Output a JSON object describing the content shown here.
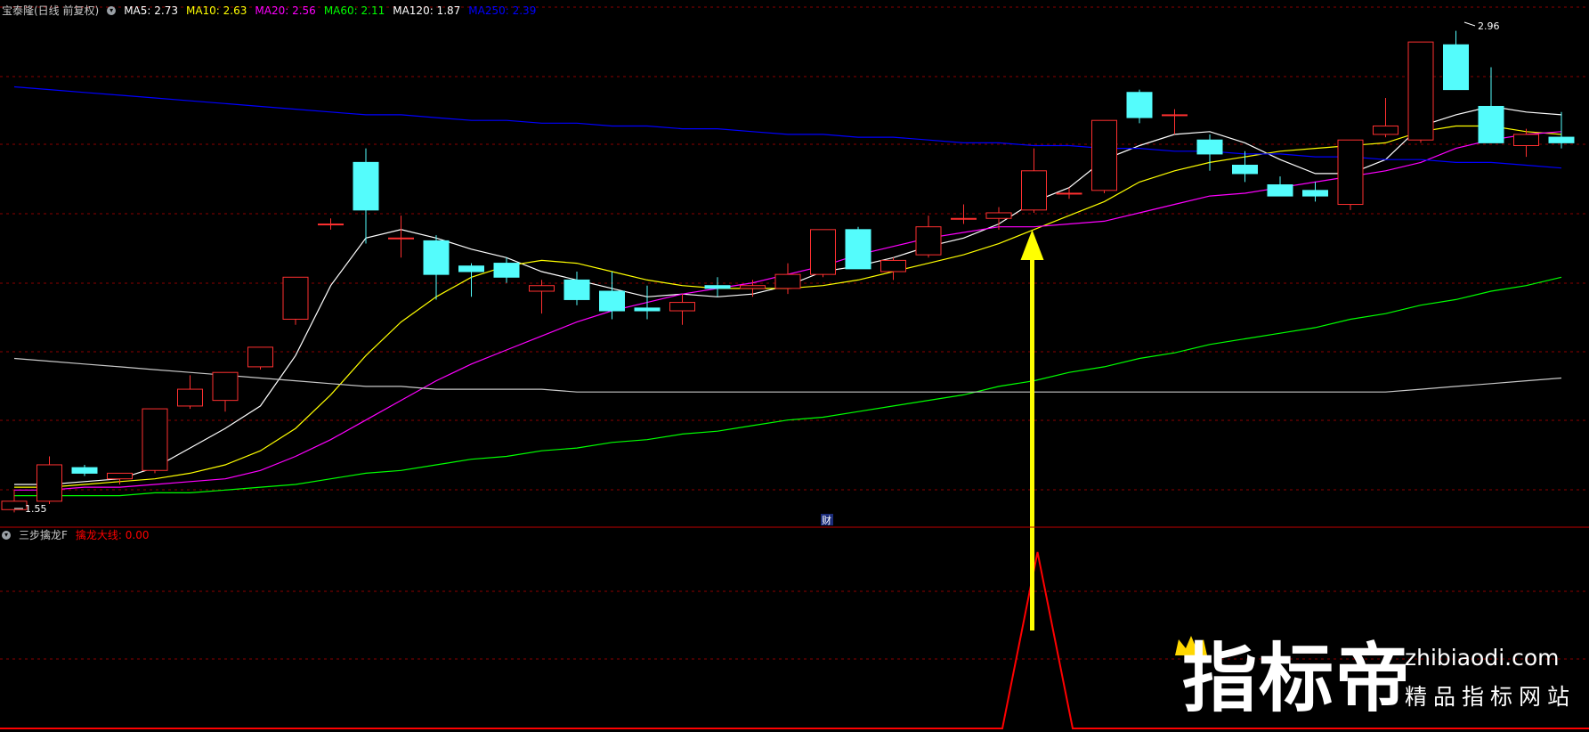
{
  "main_panel": {
    "title": "宝泰隆(日线 前复权)",
    "ma_labels": [
      {
        "text": "MA5: 2.73",
        "color": "#ffffff"
      },
      {
        "text": "MA10: 2.63",
        "color": "#ffff00"
      },
      {
        "text": "MA20: 2.56",
        "color": "#ff00ff"
      },
      {
        "text": "MA60: 2.11",
        "color": "#00ff00"
      },
      {
        "text": "MA120: 1.87",
        "color": "#ffffff"
      },
      {
        "text": "MA250: 2.39",
        "color": "#0000ff"
      }
    ],
    "high_marker": "2.96",
    "low_marker": "1.55",
    "fin_badge": "财"
  },
  "sub_panel": {
    "title": "三步擒龙F",
    "indicator_label": "擒龙大线: 0.00",
    "indicator_color": "#ff0000"
  },
  "watermark": {
    "brand": "指标帝",
    "url": "zhibiaodi.com",
    "slogan": "精品指标网站"
  },
  "colors": {
    "up": "#ff3030",
    "down": "#54fcfc",
    "grid": "#8b0000",
    "arrow": "#ffff00"
  },
  "chart_data": {
    "type": "candlestick",
    "ohlc": [
      [
        1.55,
        1.62,
        1.54,
        1.58
      ],
      [
        1.58,
        1.74,
        1.57,
        1.71
      ],
      [
        1.7,
        1.71,
        1.67,
        1.68
      ],
      [
        1.66,
        1.68,
        1.64,
        1.68
      ],
      [
        1.69,
        1.91,
        1.68,
        1.91
      ],
      [
        1.92,
        2.03,
        1.91,
        1.98
      ],
      [
        1.94,
        2.04,
        1.9,
        2.04
      ],
      [
        2.06,
        2.13,
        2.05,
        2.13
      ],
      [
        2.23,
        2.38,
        2.21,
        2.38
      ],
      [
        2.57,
        2.59,
        2.55,
        2.57
      ],
      [
        2.79,
        2.84,
        2.5,
        2.62
      ],
      [
        2.52,
        2.6,
        2.45,
        2.52
      ],
      [
        2.51,
        2.53,
        2.3,
        2.39
      ],
      [
        2.42,
        2.43,
        2.31,
        2.4
      ],
      [
        2.43,
        2.45,
        2.36,
        2.38
      ],
      [
        2.33,
        2.37,
        2.25,
        2.35
      ],
      [
        2.37,
        2.4,
        2.28,
        2.3
      ],
      [
        2.33,
        2.4,
        2.23,
        2.26
      ],
      [
        2.27,
        2.35,
        2.23,
        2.26
      ],
      [
        2.26,
        2.32,
        2.21,
        2.29
      ],
      [
        2.35,
        2.38,
        2.31,
        2.34
      ],
      [
        2.34,
        2.37,
        2.31,
        2.35
      ],
      [
        2.34,
        2.43,
        2.32,
        2.39
      ],
      [
        2.39,
        2.55,
        2.38,
        2.55
      ],
      [
        2.55,
        2.56,
        2.41,
        2.41
      ],
      [
        2.4,
        2.45,
        2.37,
        2.44
      ],
      [
        2.46,
        2.6,
        2.45,
        2.56
      ],
      [
        2.59,
        2.64,
        2.57,
        2.59
      ],
      [
        2.59,
        2.63,
        2.55,
        2.61
      ],
      [
        2.62,
        2.84,
        2.61,
        2.76
      ],
      [
        2.68,
        2.7,
        2.66,
        2.68
      ],
      [
        2.69,
        2.93,
        2.68,
        2.94
      ],
      [
        3.04,
        3.05,
        2.93,
        2.95
      ],
      [
        2.96,
        2.98,
        2.89,
        2.96
      ],
      [
        2.87,
        2.89,
        2.76,
        2.82
      ],
      [
        2.78,
        2.83,
        2.72,
        2.75
      ],
      [
        2.71,
        2.74,
        2.67,
        2.67
      ],
      [
        2.69,
        2.72,
        2.65,
        2.67
      ],
      [
        2.64,
        2.87,
        2.62,
        2.87
      ],
      [
        2.89,
        3.02,
        2.88,
        2.92
      ],
      [
        2.87,
        3.22,
        2.86,
        3.22
      ],
      [
        3.21,
        3.26,
        3.05,
        3.05
      ],
      [
        2.99,
        3.13,
        2.87,
        2.86
      ],
      [
        2.85,
        2.91,
        2.81,
        2.89
      ],
      [
        2.88,
        2.97,
        2.84,
        2.86
      ]
    ],
    "ma_series": [
      {
        "name": "MA5",
        "color": "#ffffff",
        "y": [
          1.64,
          1.64,
          1.65,
          1.66,
          1.7,
          1.77,
          1.84,
          1.92,
          2.1,
          2.35,
          2.52,
          2.55,
          2.52,
          2.48,
          2.45,
          2.4,
          2.37,
          2.34,
          2.31,
          2.32,
          2.31,
          2.32,
          2.35,
          2.4,
          2.42,
          2.45,
          2.49,
          2.52,
          2.57,
          2.65,
          2.7,
          2.8,
          2.85,
          2.89,
          2.9,
          2.86,
          2.8,
          2.75,
          2.75,
          2.8,
          2.92,
          2.96,
          2.99,
          2.97,
          2.96
        ]
      },
      {
        "name": "MA10",
        "color": "#ffff00",
        "y": [
          1.63,
          1.63,
          1.64,
          1.65,
          1.66,
          1.68,
          1.71,
          1.76,
          1.84,
          1.96,
          2.1,
          2.22,
          2.31,
          2.38,
          2.42,
          2.44,
          2.43,
          2.4,
          2.37,
          2.35,
          2.34,
          2.34,
          2.34,
          2.35,
          2.37,
          2.4,
          2.43,
          2.46,
          2.5,
          2.55,
          2.6,
          2.65,
          2.72,
          2.76,
          2.79,
          2.81,
          2.83,
          2.84,
          2.85,
          2.86,
          2.9,
          2.92,
          2.92,
          2.9,
          2.89
        ]
      },
      {
        "name": "MA20",
        "color": "#ff00ff",
        "y": [
          1.62,
          1.62,
          1.63,
          1.63,
          1.64,
          1.65,
          1.66,
          1.69,
          1.74,
          1.8,
          1.87,
          1.94,
          2.01,
          2.07,
          2.12,
          2.17,
          2.22,
          2.26,
          2.29,
          2.32,
          2.34,
          2.36,
          2.39,
          2.42,
          2.46,
          2.49,
          2.52,
          2.54,
          2.56,
          2.56,
          2.57,
          2.58,
          2.61,
          2.64,
          2.67,
          2.68,
          2.7,
          2.72,
          2.74,
          2.76,
          2.79,
          2.84,
          2.87,
          2.89,
          2.9
        ]
      },
      {
        "name": "MA60",
        "color": "#00ff00",
        "y": [
          1.6,
          1.6,
          1.6,
          1.6,
          1.61,
          1.61,
          1.62,
          1.63,
          1.64,
          1.66,
          1.68,
          1.69,
          1.71,
          1.73,
          1.74,
          1.76,
          1.77,
          1.79,
          1.8,
          1.82,
          1.83,
          1.85,
          1.87,
          1.88,
          1.9,
          1.92,
          1.94,
          1.96,
          1.99,
          2.01,
          2.04,
          2.06,
          2.09,
          2.11,
          2.14,
          2.16,
          2.18,
          2.2,
          2.23,
          2.25,
          2.28,
          2.3,
          2.33,
          2.35,
          2.38
        ]
      },
      {
        "name": "MA120",
        "color": "#c8c8c8",
        "y": [
          2.09,
          2.08,
          2.07,
          2.06,
          2.05,
          2.04,
          2.03,
          2.02,
          2.01,
          2.0,
          1.99,
          1.99,
          1.98,
          1.98,
          1.98,
          1.98,
          1.97,
          1.97,
          1.97,
          1.97,
          1.97,
          1.97,
          1.97,
          1.97,
          1.97,
          1.97,
          1.97,
          1.97,
          1.97,
          1.97,
          1.97,
          1.97,
          1.97,
          1.97,
          1.97,
          1.97,
          1.97,
          1.97,
          1.97,
          1.97,
          1.98,
          1.99,
          2.0,
          2.01,
          2.02
        ]
      },
      {
        "name": "MA250",
        "color": "#0000ff",
        "y": [
          3.06,
          3.05,
          3.04,
          3.03,
          3.02,
          3.01,
          3.0,
          2.99,
          2.98,
          2.97,
          2.96,
          2.96,
          2.95,
          2.94,
          2.94,
          2.93,
          2.93,
          2.92,
          2.92,
          2.91,
          2.91,
          2.9,
          2.89,
          2.89,
          2.88,
          2.88,
          2.87,
          2.86,
          2.86,
          2.85,
          2.85,
          2.84,
          2.84,
          2.83,
          2.83,
          2.82,
          2.82,
          2.81,
          2.81,
          2.8,
          2.8,
          2.79,
          2.79,
          2.78,
          2.77
        ]
      }
    ],
    "indicator": {
      "name": "擒龙大线",
      "y": [
        0,
        0,
        0,
        0,
        0,
        0,
        0,
        0,
        0,
        0,
        0,
        0,
        0,
        0,
        0,
        0,
        0,
        0,
        0,
        0,
        0,
        0,
        0,
        0,
        0,
        0,
        0,
        0,
        0,
        1,
        0,
        0,
        0,
        0,
        0,
        0,
        0,
        0,
        0,
        0,
        0,
        0,
        0,
        0,
        0
      ],
      "signal_index": 29
    },
    "ylim": [
      1.5,
      3.3
    ]
  }
}
